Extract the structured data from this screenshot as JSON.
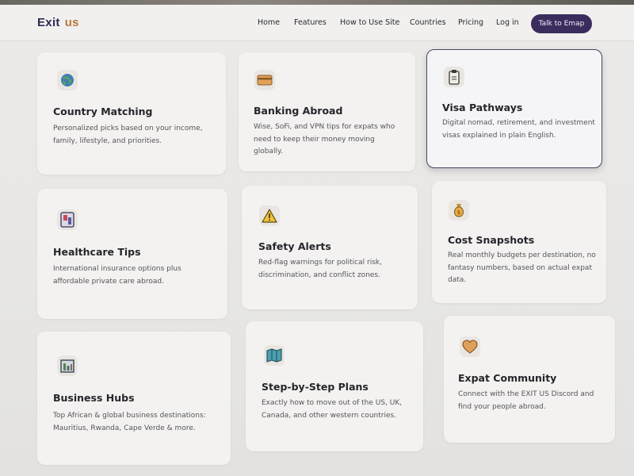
{
  "brand": {
    "part1": "Exit",
    "part2": "us"
  },
  "nav": {
    "items": [
      "Home",
      "Features",
      "How to Use Site",
      "Countries",
      "Pricing",
      "Log in"
    ],
    "cta": "Talk to Emap"
  },
  "cards": [
    {
      "icon": "globe-icon",
      "title": "Country Matching",
      "desc": "Personalized picks based on your income, family, lifestyle, and priorities."
    },
    {
      "icon": "credit-card-icon",
      "title": "Banking Abroad",
      "desc": "Wise, SoFi, and VPN tips for expats who need to keep their money moving globally."
    },
    {
      "icon": "clipboard-icon",
      "title": "Visa Pathways",
      "desc": "Digital nomad, retirement, and investment visas explained in plain English."
    },
    {
      "icon": "medical-kit-icon",
      "title": "Healthcare Tips",
      "desc": "International insurance options plus affordable private care abroad."
    },
    {
      "icon": "warning-icon",
      "title": "Safety Alerts",
      "desc": "Red-flag warnings for political risk, discrimination, and conflict zones."
    },
    {
      "icon": "money-bag-icon",
      "title": "Cost Snapshots",
      "desc": "Real monthly budgets per destination, no fantasy numbers, based on actual expat data."
    },
    {
      "icon": "building-icon",
      "title": "Business Hubs",
      "desc": "Top African & global business destinations: Mauritius, Rwanda, Cape Verde & more."
    },
    {
      "icon": "map-icon",
      "title": "Step-by-Step Plans",
      "desc": "Exactly how to move out of the US, UK, Canada, and other western countries."
    },
    {
      "icon": "heart-icon",
      "title": "Expat Community",
      "desc": "Connect with the EXIT US Discord and find your people abroad."
    }
  ]
}
